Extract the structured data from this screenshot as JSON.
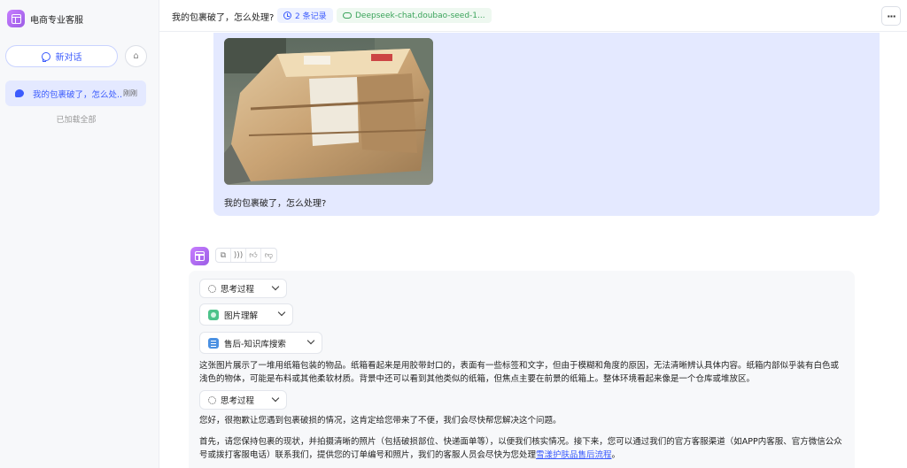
{
  "app": {
    "title": "电商专业客服"
  },
  "sidebar": {
    "new_chat_label": "新对话",
    "conversations": [
      {
        "title": "我的包裹破了，怎么处...",
        "time": "刚刚"
      }
    ],
    "loaded_all_text": "已加载全部"
  },
  "header": {
    "title": "我的包裹破了，怎么处理?",
    "records_chip": "2 条记录",
    "models_chip": "Deepseek-chat,doubao-seed-1..."
  },
  "user_message": {
    "text": "我的包裹破了，怎么处理?",
    "image_alt": "damaged cardboard package"
  },
  "assistant": {
    "pills": {
      "thinking_1": "思考过程",
      "image_understanding": "图片理解",
      "kb_search": "售后-知识库搜索",
      "thinking_2": "思考过程"
    },
    "image_description": "这张图片展示了一堆用纸箱包装的物品。纸箱看起来是用胶带封口的，表面有一些标签和文字，但由于模糊和角度的原因，无法清晰辨认具体内容。纸箱内部似乎装有白色或浅色的物体，可能是布料或其他柔软材质。背景中还可以看到其他类似的纸箱，但焦点主要在前景的纸箱上。整体环境看起来像是一个仓库或堆放区。",
    "reply_1": "您好，很抱歉让您遇到包裹破损的情况，这肯定给您带来了不便，我们会尽快帮您解决这个问题。",
    "reply_2_prefix": "首先，请您保持包裹的现状，并拍摄清晰的照片（包括破损部位、快递面单等），以便我们核实情况。接下来，您可以通过我们的官方客服渠道（如APP内客服、官方微信公众号或拨打客服电话）联系我们，提供您的订单编号和照片，我们的客服人员会尽快为您处理",
    "reply_2_link": "雪漾护肤品售后流程",
    "reply_2_suffix": "。"
  }
}
